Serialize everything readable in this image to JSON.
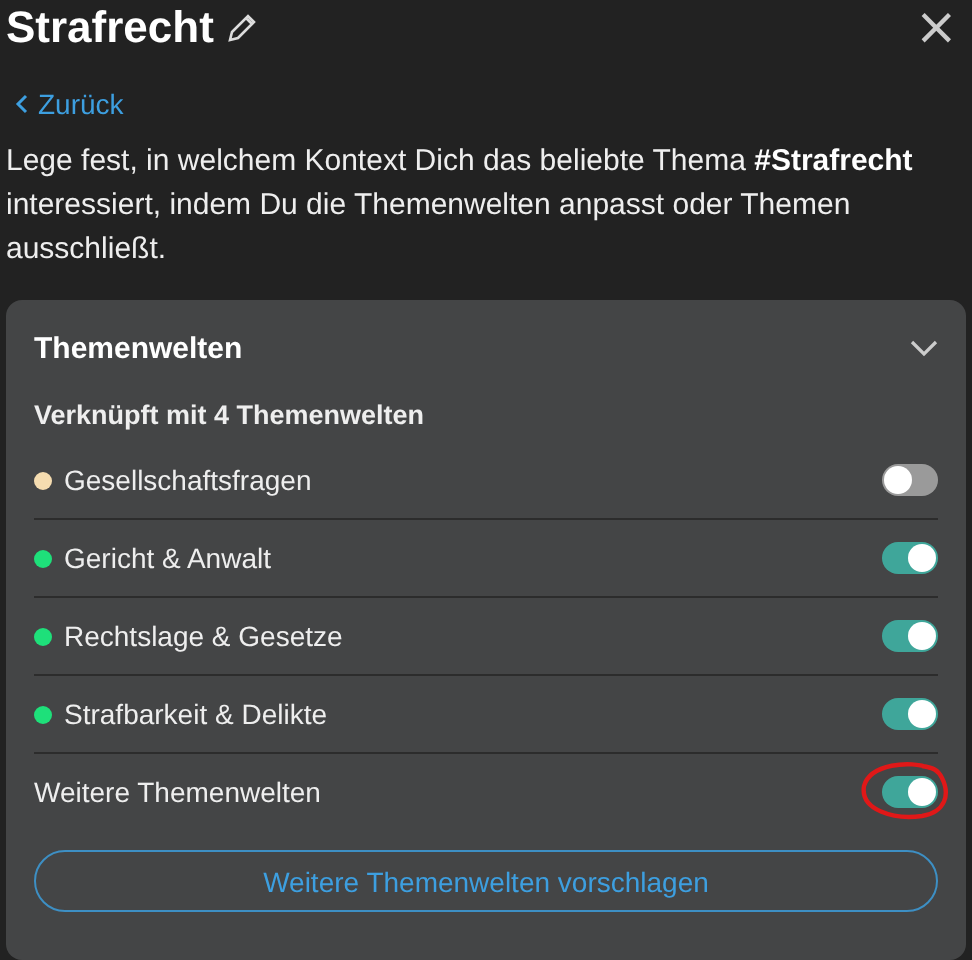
{
  "header": {
    "title": "Strafrecht",
    "close": "×"
  },
  "back_link": "Zurück",
  "description": "Lege fest, in welchem Kontext Dich das beliebte Thema **#Strafrecht** interessiert, indem Du die Themenwelten anpasst oder Themen ausschließt.",
  "panel": {
    "title": "Themenwelten",
    "expanded": true,
    "subtitle": "Verknüpft mit 4 Themenwelten",
    "items": [
      {
        "kind": "topic",
        "label": "Gesellschaftsfragen",
        "color": "#f5dcb0",
        "on": false,
        "circled": false
      },
      {
        "kind": "topic",
        "label": "Gericht & Anwalt",
        "color": "#1ee07a",
        "on": true,
        "circled": false
      },
      {
        "kind": "topic",
        "label": "Rechtslage & Gesetze",
        "color": "#1ee07a",
        "on": true,
        "circled": false
      },
      {
        "kind": "topic",
        "label": "Strafbarkeit & Delikte",
        "color": "#1ee07a",
        "on": true,
        "circled": false
      },
      {
        "kind": "setting",
        "label": "Weitere Themenwelten",
        "on": true,
        "circled": true
      }
    ],
    "button": "Weitere Themenwelten vorschlagen"
  }
}
